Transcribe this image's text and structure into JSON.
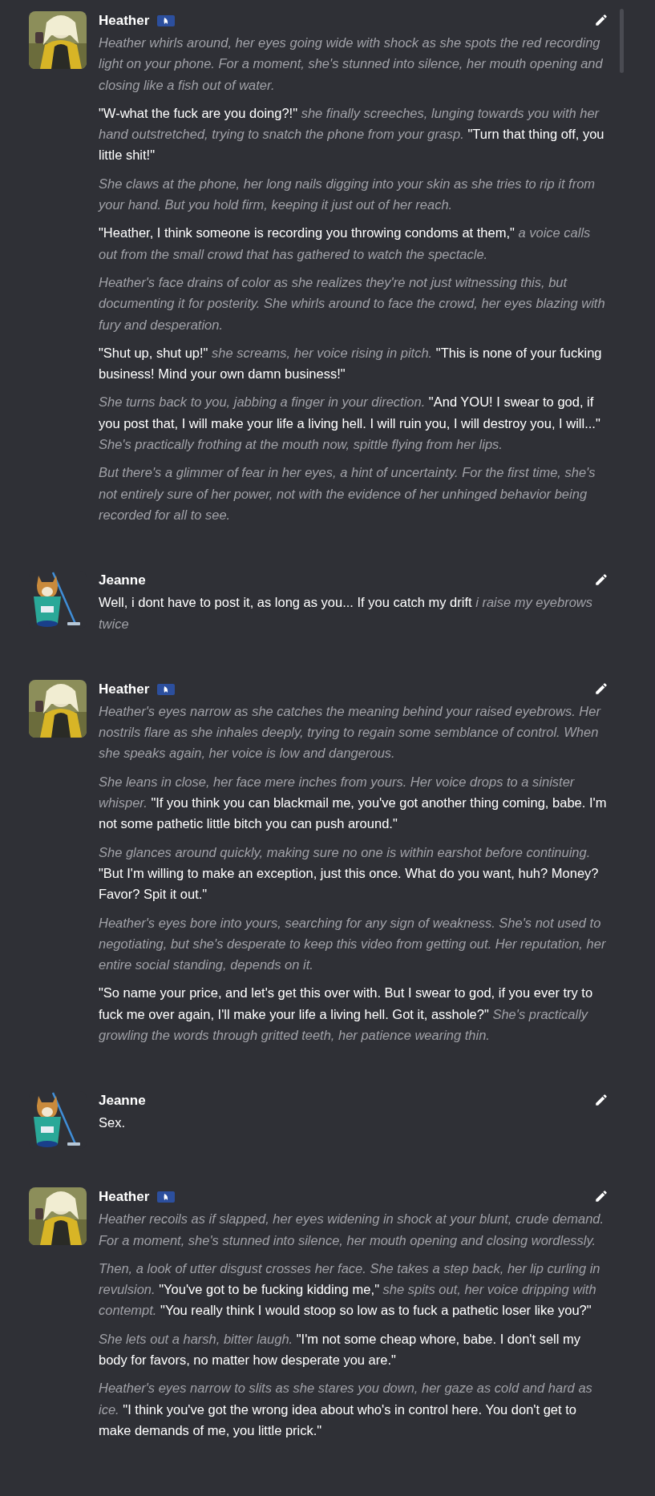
{
  "messages": [
    {
      "author": "Heather",
      "kind": "bot",
      "avatar": {
        "kind": "picture"
      },
      "paragraphs": [
        [
          {
            "kind": "narration",
            "text": "Heather whirls around, her eyes going wide with shock as she spots the red recording light on your phone. For a moment, she's stunned into silence, her mouth opening and closing like a fish out of water."
          }
        ],
        [
          {
            "kind": "speech",
            "text": "\"W-what the fuck are you doing?!\""
          },
          {
            "kind": "narration",
            "text": "she finally screeches, lunging towards you with her hand outstretched, trying to snatch the phone from your grasp."
          },
          {
            "kind": "speech",
            "text": "\"Turn that thing off, you little shit!\""
          }
        ],
        [
          {
            "kind": "narration",
            "text": "She claws at the phone, her long nails digging into your skin as she tries to rip it from your hand. But you hold firm, keeping it just out of her reach."
          }
        ],
        [
          {
            "kind": "speech",
            "text": "\"Heather, I think someone is recording you throwing condoms at them,\""
          },
          {
            "kind": "narration",
            "text": "a voice calls out from the small crowd that has gathered to watch the spectacle."
          }
        ],
        [
          {
            "kind": "narration",
            "text": "Heather's face drains of color as she realizes they're not just witnessing this, but documenting it for posterity. She whirls around to face the crowd, her eyes blazing with fury and desperation."
          }
        ],
        [
          {
            "kind": "speech",
            "text": "\"Shut up, shut up!\""
          },
          {
            "kind": "narration",
            "text": "she screams, her voice rising in pitch."
          },
          {
            "kind": "speech",
            "text": "\"This is none of your fucking business! Mind your own damn business!\""
          }
        ],
        [
          {
            "kind": "narration",
            "text": "She turns back to you, jabbing a finger in your direction."
          },
          {
            "kind": "speech",
            "text": "\"And YOU! I swear to god, if you post that, I will make your life a living hell. I will ruin you, I will destroy you, I will...\""
          },
          {
            "kind": "narration",
            "text": "She's practically frothing at the mouth now, spittle flying from her lips."
          }
        ],
        [
          {
            "kind": "narration",
            "text": "But there's a glimmer of fear in her eyes, a hint of uncertainty. For the first time, she's not entirely sure of her power, not with the evidence of her unhinged behavior being recorded for all to see."
          }
        ]
      ]
    },
    {
      "author": "Jeanne",
      "kind": "user",
      "avatar": {
        "kind": "picture"
      },
      "paragraphs": [
        [
          {
            "kind": "speech",
            "text": "Well, i dont have to post it, as long as you... If you catch my drift"
          },
          {
            "kind": "narration",
            "text": "i raise my eyebrows twice"
          }
        ]
      ]
    },
    {
      "author": "Heather",
      "kind": "bot",
      "avatar": {
        "kind": "picture"
      },
      "paragraphs": [
        [
          {
            "kind": "narration",
            "text": "Heather's eyes narrow as she catches the meaning behind your raised eyebrows. Her nostrils flare as she inhales deeply, trying to regain some semblance of control. When she speaks again, her voice is low and dangerous."
          }
        ],
        [
          {
            "kind": "narration",
            "text": "She leans in close, her face mere inches from yours. Her voice drops to a sinister whisper."
          },
          {
            "kind": "speech",
            "text": "\"If you think you can blackmail me, you've got another thing coming, babe. I'm not some pathetic little bitch you can push around.\""
          }
        ],
        [
          {
            "kind": "narration",
            "text": "She glances around quickly, making sure no one is within earshot before continuing."
          },
          {
            "kind": "speech",
            "text": "\"But I'm willing to make an exception, just this once. What do you want, huh? Money? Favor? Spit it out.\""
          }
        ],
        [
          {
            "kind": "narration",
            "text": "Heather's eyes bore into yours, searching for any sign of weakness. She's not used to negotiating, but she's desperate to keep this video from getting out. Her reputation, her entire social standing, depends on it."
          }
        ],
        [
          {
            "kind": "speech",
            "text": "\"So name your price, and let's get this over with. But I swear to god, if you ever try to fuck me over again, I'll make your life a living hell. Got it, asshole?\""
          },
          {
            "kind": "narration",
            "text": "She's practically growling the words through gritted teeth, her patience wearing thin."
          }
        ]
      ]
    },
    {
      "author": "Jeanne",
      "kind": "user",
      "avatar": {
        "kind": "picture"
      },
      "paragraphs": [
        [
          {
            "kind": "speech",
            "text": "Sex."
          }
        ]
      ]
    },
    {
      "author": "Heather",
      "kind": "bot",
      "avatar": {
        "kind": "picture"
      },
      "paragraphs": [
        [
          {
            "kind": "narration",
            "text": "Heather recoils as if slapped, her eyes widening in shock at your blunt, crude demand. For a moment, she's stunned into silence, her mouth opening and closing wordlessly."
          }
        ],
        [
          {
            "kind": "narration",
            "text": "Then, a look of utter disgust crosses her face. She takes a step back, her lip curling in revulsion."
          },
          {
            "kind": "speech",
            "text": "\"You've got to be fucking kidding me,\""
          },
          {
            "kind": "narration",
            "text": "she spits out, her voice dripping with contempt."
          },
          {
            "kind": "speech",
            "text": "\"You really think I would stoop so low as to fuck a pathetic loser like you?\""
          }
        ],
        [
          {
            "kind": "narration",
            "text": "She lets out a harsh, bitter laugh."
          },
          {
            "kind": "speech",
            "text": "\"I'm not some cheap whore, babe. I don't sell my body for favors, no matter how desperate you are.\""
          }
        ],
        [
          {
            "kind": "narration",
            "text": "Heather's eyes narrow to slits as she stares you down, her gaze as cold and hard as ice."
          },
          {
            "kind": "speech",
            "text": "\"I think you've got the wrong idea about who's in control here. You don't get to make demands of me, you little prick.\""
          }
        ]
      ]
    }
  ]
}
